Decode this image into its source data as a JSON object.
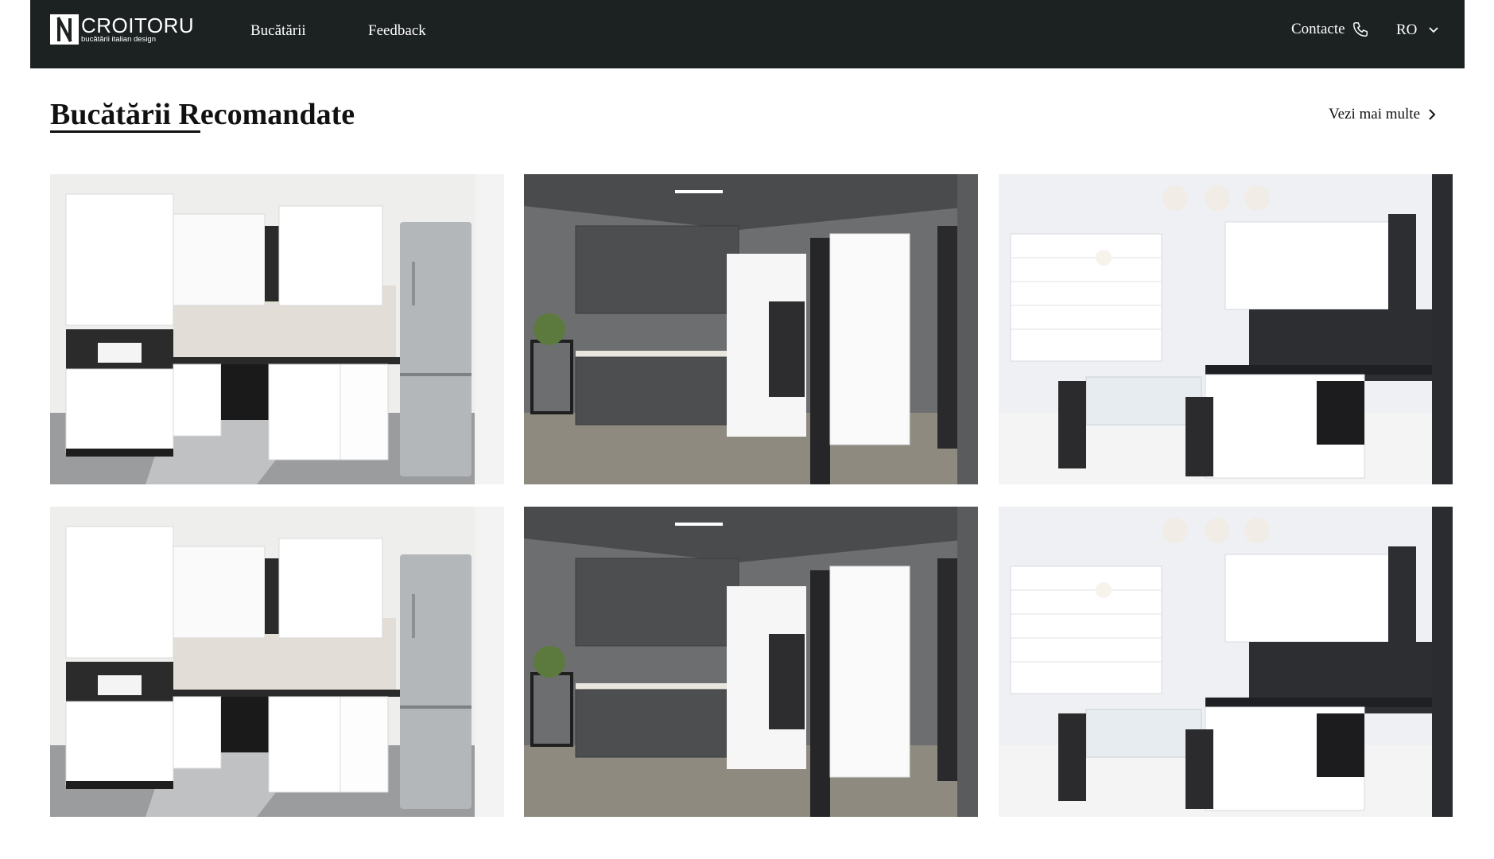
{
  "header": {
    "logo": {
      "name": "CROITORU",
      "tagline": "bucătării italian design"
    },
    "nav": [
      {
        "label": "Bucătării"
      },
      {
        "label": "Feedback"
      }
    ],
    "contact_label": "Contacte",
    "language": "RO",
    "icons": {
      "contact": "phone-icon",
      "language": "chevron-down-icon"
    }
  },
  "section": {
    "title": "Bucătării Recomandate",
    "see_more_label": "Vezi mai multe",
    "see_more_icon": "chevron-right-icon"
  },
  "gallery": [
    {
      "scene": "white-kitchen"
    },
    {
      "scene": "grey-kitchen"
    },
    {
      "scene": "dining-kitchen"
    },
    {
      "scene": "white-kitchen"
    },
    {
      "scene": "grey-kitchen"
    },
    {
      "scene": "dining-kitchen"
    }
  ],
  "colors": {
    "header_bg": "#1c2121",
    "page_bg": "#ffffff",
    "text": "#111111"
  }
}
